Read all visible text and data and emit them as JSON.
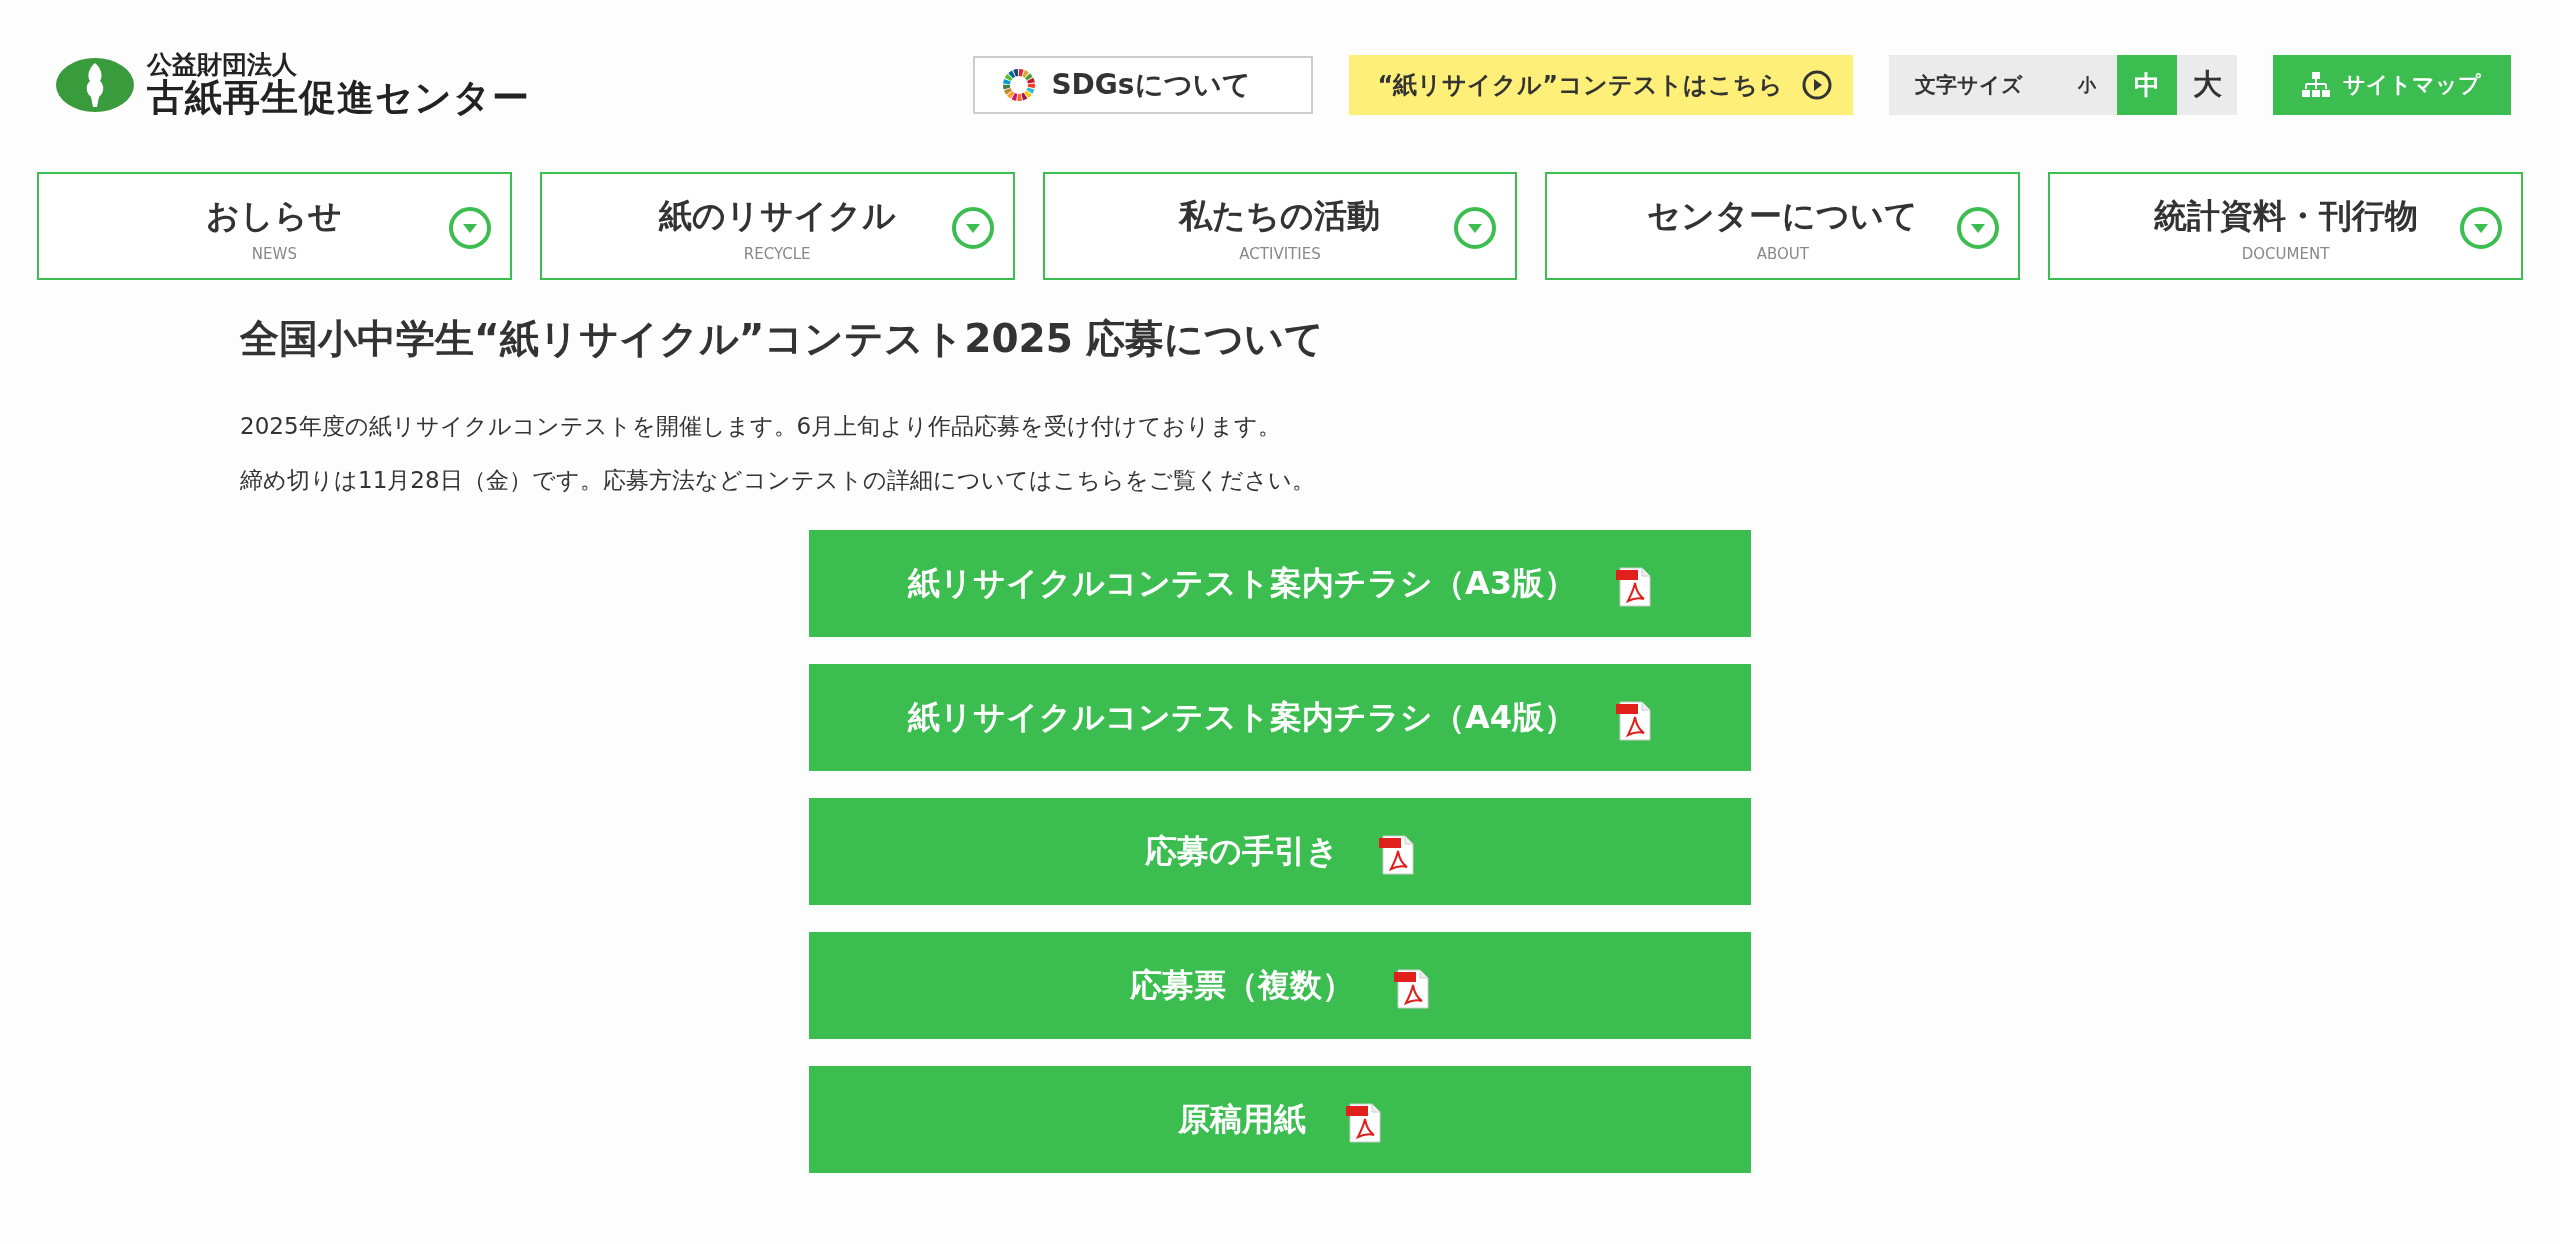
{
  "header": {
    "logo_sub": "公益財団法人",
    "logo_main": "古紙再生促進センター",
    "sdgs_link": "SDGsについて",
    "contest_link": "“紙リサイクル”コンテストはこちら",
    "font_size": {
      "label": "文字サイズ",
      "options": [
        {
          "label": "小",
          "selected": false
        },
        {
          "label": "中",
          "selected": true
        },
        {
          "label": "大",
          "selected": false
        }
      ]
    },
    "sitemap": "サイトマップ"
  },
  "nav": [
    {
      "label": "おしらせ",
      "sub": "NEWS"
    },
    {
      "label": "紙のリサイクル",
      "sub": "RECYCLE"
    },
    {
      "label": "私たちの活動",
      "sub": "ACTIVITIES"
    },
    {
      "label": "センターについて",
      "sub": "ABOUT"
    },
    {
      "label": "統計資料・刊行物",
      "sub": "DOCUMENT"
    }
  ],
  "article": {
    "title": "全国小中学生“紙リサイクル”コンテスト2025 応募について",
    "paragraphs": [
      "2025年度の紙リサイクルコンテストを開催します。6月上旬より作品応募を受け付けております。",
      "締め切りは11月28日（金）です。応募方法などコンテストの詳細についてはこちらをご覧ください。"
    ],
    "downloads": [
      {
        "label": "紙リサイクルコンテスト案内チラシ（A3版）"
      },
      {
        "label": "紙リサイクルコンテスト案内チラシ（A4版）"
      },
      {
        "label": "応募の手引き"
      },
      {
        "label": "応募票（複数）"
      },
      {
        "label": "原稿用紙"
      }
    ]
  }
}
